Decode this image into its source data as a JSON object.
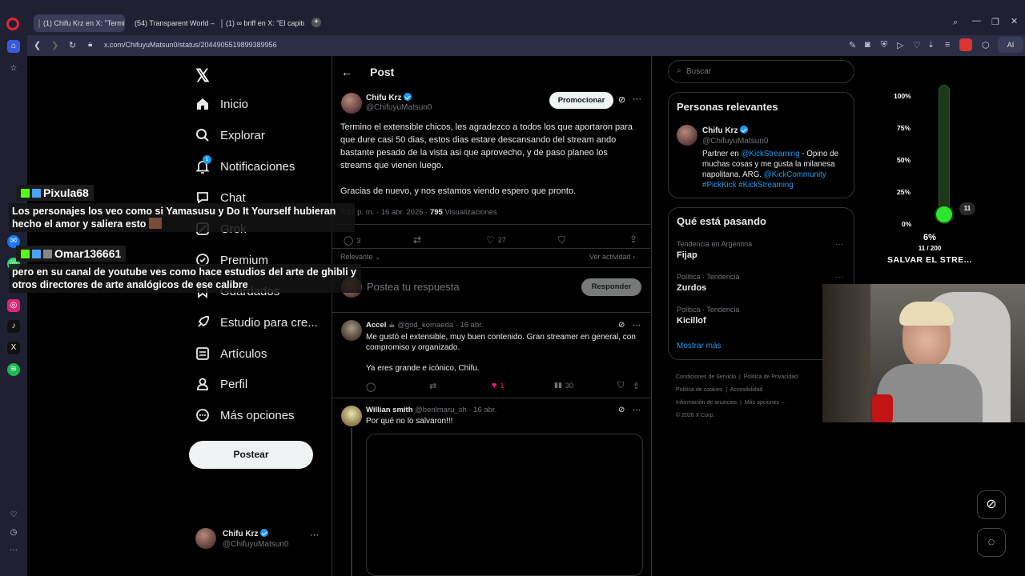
{
  "browser": {
    "tabs": [
      {
        "label": "(1) Chifu Krz en X: \"Termin",
        "active": true
      },
      {
        "label": "(54) Transparent World – ",
        "active": false
      },
      {
        "label": "(1) ∞ briff en X: \"El capitul",
        "active": false
      }
    ],
    "url": "x.com/ChifuyuMatsun0/status/2044905519899389956",
    "ai_label": "AI"
  },
  "nav": {
    "items": [
      {
        "label": "Inicio",
        "icon": "home-icon"
      },
      {
        "label": "Explorar",
        "icon": "search-icon"
      },
      {
        "label": "Notificaciones",
        "icon": "bell-icon",
        "badge": "1"
      },
      {
        "label": "Chat",
        "icon": "chat-icon"
      },
      {
        "label": "Grok",
        "icon": "grok-icon"
      },
      {
        "label": "Premium",
        "icon": "premium-icon"
      },
      {
        "label": "Guardados",
        "icon": "bookmark-icon"
      },
      {
        "label": "Estudio para cre...",
        "icon": "rocket-icon"
      },
      {
        "label": "Artículos",
        "icon": "article-icon"
      },
      {
        "label": "Perfil",
        "icon": "user-icon"
      },
      {
        "label": "Más opciones",
        "icon": "more-icon"
      }
    ],
    "post_button": "Postear",
    "account": {
      "name": "Chifu Krz",
      "handle": "@ChifuyuMatsun0"
    }
  },
  "post": {
    "header": "Post",
    "author": {
      "name": "Chifu Krz",
      "handle": "@ChifuyuMatsun0"
    },
    "promote_label": "Promocionar",
    "text_p1": "Termino el extensible chicos, les agradezco a todos los que aportaron para que dure casi 50 dias, estos dias estare descansando del stream ando bastante pesado de la vista asi que aprovecho, y de paso planeo los streams que vienen luego.",
    "text_p2": "Gracias de nuevo, y nos estamos viendo espero que pronto.",
    "time": "7:27 p. m. · 16 abr. 2026 · ",
    "views_count": "795",
    "views_label": " Visualizaciones",
    "replies": "3",
    "likes": "27",
    "relevance_label": "Relevante",
    "activity_label": "Ver actividad",
    "reply_placeholder": "Postea tu respuesta",
    "reply_button": "Responder"
  },
  "replies": [
    {
      "name": "Accel",
      "handle": "@god_komaeda · 16 abr.",
      "text_p1": "Me gustó el extensible, muy buen contenido. Gran streamer en general, con compromiso y organizado.",
      "text_p2": "Ya eres grande e icónico, Chifu.",
      "likes": "1",
      "views": "30"
    },
    {
      "name": "Willian smith",
      "handle": "@benlmaru_sh · 16 abr.",
      "text_p1": "Por qué no lo salvaron!!!"
    }
  ],
  "right": {
    "search_placeholder": "Buscar",
    "relevant_title": "Personas relevantes",
    "relevant": {
      "name": "Chifu Krz",
      "handle": "@ChifuyuMatsun0",
      "bio_1": "Partner en ",
      "bio_link1": "@KickStreaming",
      "bio_2": " - Opino de muchas cosas y me gusta la milanesa napolitana. ARG. ",
      "bio_link2": "@KickCommunity #PickKick #KickStreaming"
    },
    "trends_title": "Qué está pasando",
    "trends": [
      {
        "cat": "Tendencia en Argentina",
        "name": "Fijap"
      },
      {
        "cat": "Política · Tendencia",
        "name": "Zurdos"
      },
      {
        "cat": "Política · Tendencia",
        "name": "Kicillof"
      }
    ],
    "show_more": "Mostrar más",
    "footer_row1": [
      "Condiciones de Servicio",
      "Política de Privacidad"
    ],
    "footer_row2": [
      "Política de cookies",
      "Accesibilidad"
    ],
    "footer_row3": [
      "Información de anuncios",
      "Más opciones ···"
    ],
    "copyright": "© 2026 X Corp."
  },
  "overlay": {
    "gauge_ticks": [
      "100%",
      "75%",
      "50%",
      "25%",
      "0%"
    ],
    "gauge_value_pct": 6,
    "gauge_marker": "11",
    "gauge_percent": "6%",
    "gauge_count": "11 / 200",
    "gauge_title": "SALVAR EL STRE...",
    "chat": [
      {
        "user": "Pixula68",
        "message": "Los personajes los veo como si Yamasusu y Do It Yourself hubieran hecho el amor y saliera esto"
      },
      {
        "user": "Omar136661",
        "message": "pero en su canal de youtube ves como hace estudios del arte de ghibli y otros directores de arte analógicos de ese calibre"
      }
    ]
  },
  "colors": {
    "accent": "#1d9bf0",
    "like": "#f91880",
    "gauge": "#2ee52e",
    "kick": "#53fc18"
  }
}
